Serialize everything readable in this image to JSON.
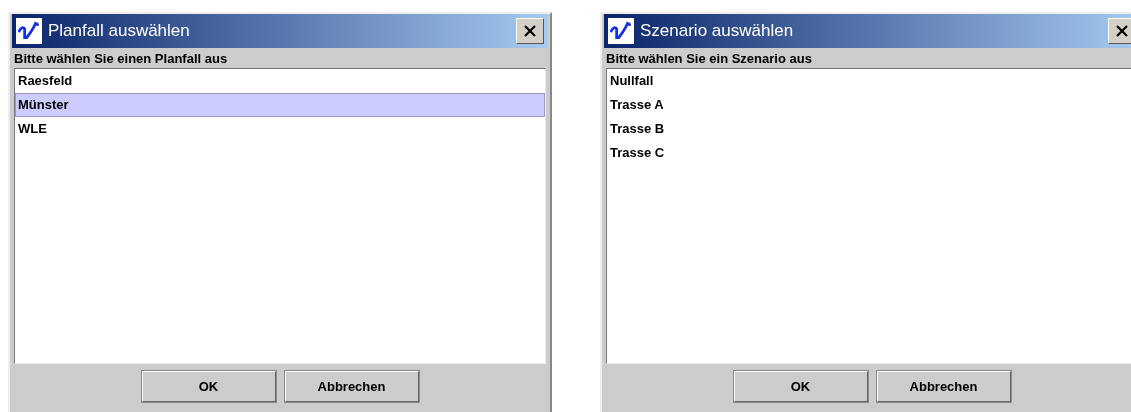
{
  "dialogs": [
    {
      "title": "Planfall auswählen",
      "prompt": "Bitte wählen Sie einen Planfall aus",
      "items": [
        {
          "label": "Raesfeld",
          "selected": false
        },
        {
          "label": "Münster",
          "selected": true
        },
        {
          "label": "WLE",
          "selected": false
        }
      ],
      "buttons": [
        "OK",
        "Abbrechen"
      ]
    },
    {
      "title": "Szenario auswählen",
      "prompt": "Bitte wählen Sie ein Szenario aus",
      "items": [
        {
          "label": "Nullfall",
          "selected": false
        },
        {
          "label": "Trasse A",
          "selected": false
        },
        {
          "label": "Trasse B",
          "selected": false
        },
        {
          "label": "Trasse C",
          "selected": false
        }
      ],
      "buttons": [
        "OK",
        "Abbrechen"
      ]
    }
  ]
}
